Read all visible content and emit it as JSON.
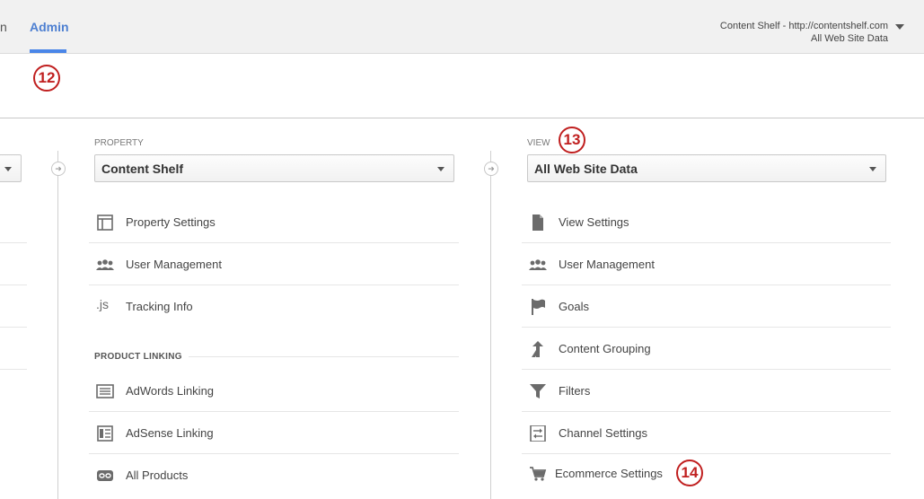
{
  "nav": {
    "partial_tab": "n",
    "admin_tab": "Admin"
  },
  "account": {
    "line1": "Content Shelf - http://contentshelf.com",
    "line2": "All Web Site Data"
  },
  "callouts": {
    "c12": "12",
    "c13": "13",
    "c14": "14"
  },
  "property": {
    "label": "PROPERTY",
    "selected": "Content Shelf",
    "items": [
      {
        "label": "Property Settings",
        "icon": "property-settings-icon"
      },
      {
        "label": "User Management",
        "icon": "users-icon"
      },
      {
        "label": "Tracking Info",
        "icon": "js-icon"
      }
    ],
    "section": "PRODUCT LINKING",
    "linking": [
      {
        "label": "AdWords Linking",
        "icon": "adwords-icon"
      },
      {
        "label": "AdSense Linking",
        "icon": "adsense-icon"
      },
      {
        "label": "All Products",
        "icon": "link-icon"
      }
    ]
  },
  "view": {
    "label": "VIEW",
    "selected": "All Web Site Data",
    "items": [
      {
        "label": "View Settings",
        "icon": "document-icon"
      },
      {
        "label": "User Management",
        "icon": "users-icon"
      },
      {
        "label": "Goals",
        "icon": "flag-icon"
      },
      {
        "label": "Content Grouping",
        "icon": "grouping-icon"
      },
      {
        "label": "Filters",
        "icon": "filter-icon"
      },
      {
        "label": "Channel Settings",
        "icon": "channel-icon"
      },
      {
        "label": "Ecommerce Settings",
        "icon": "cart-icon"
      }
    ]
  }
}
